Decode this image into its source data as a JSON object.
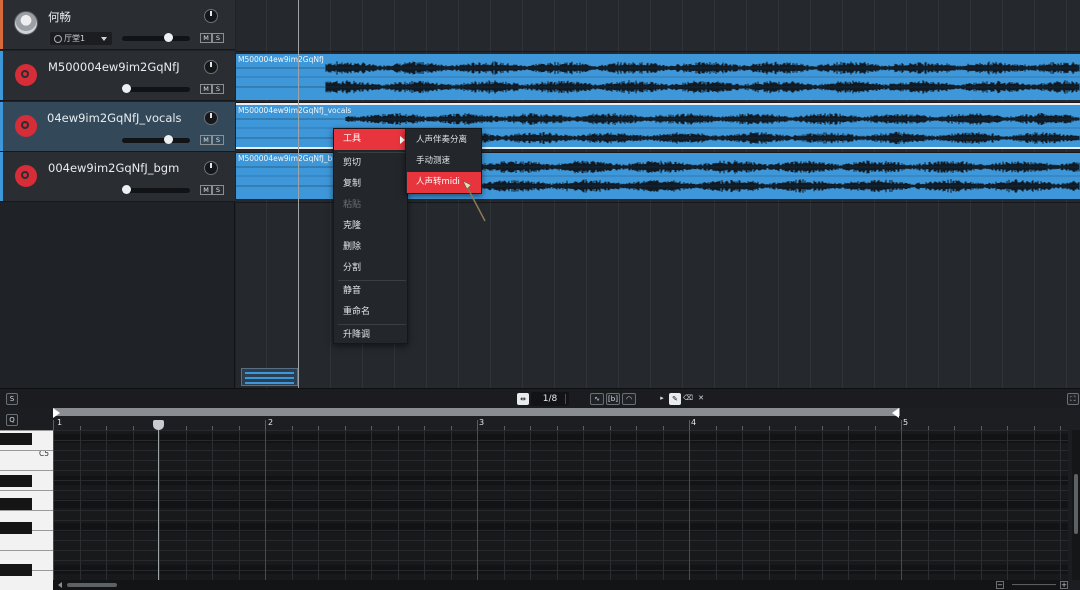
{
  "tracks": [
    {
      "name": "何畅",
      "type": "singer",
      "preset": "厅堂1",
      "strip_color": "#d8693a",
      "volume": 0.8
    },
    {
      "name": "M500004ew9im2GqNfJ",
      "type": "audio",
      "strip_color": "#3e97d9",
      "volume": 0
    },
    {
      "name": "04ew9im2GqNfJ_vocals",
      "type": "audio",
      "selected": true,
      "strip_color": "#3e97d9",
      "volume": 0.8
    },
    {
      "name": "004ew9im2GqNfJ_bgm",
      "type": "audio",
      "strip_color": "#3e97d9",
      "volume": 0
    }
  ],
  "mute_label": "M",
  "solo_label": "S",
  "clips": [
    {
      "title": "M500004ew9im2GqNfJ"
    },
    {
      "title": "M500004ew9im2GqNfJ_vocals",
      "selected": true
    },
    {
      "title": "M500004ew9im2GqNfJ_b"
    }
  ],
  "context_menu": {
    "items": [
      {
        "label": "工具",
        "active": true,
        "has_submenu": true
      },
      {
        "label": "剪切"
      },
      {
        "label": "复制"
      },
      {
        "label": "粘贴",
        "disabled": true
      },
      {
        "label": "克隆"
      },
      {
        "label": "删除"
      },
      {
        "label": "分割"
      },
      {
        "label": "静音"
      },
      {
        "label": "重命名"
      },
      {
        "label": "升降调"
      }
    ],
    "submenu": [
      {
        "label": "人声伴奏分离"
      },
      {
        "label": "手动测速"
      },
      {
        "label": "人声转midi",
        "active": true
      }
    ]
  },
  "toolbar": {
    "s_label": "S",
    "snap_value": "1/8",
    "bracket_label": "[b]",
    "q_label": "Q"
  },
  "piano_roll": {
    "bars": [
      "1",
      "2",
      "3",
      "4",
      "5"
    ],
    "octave_label": "C5"
  },
  "colors": {
    "accent": "#e8343d",
    "clip_blue": "#3e97d9",
    "record_red": "#d72d38"
  }
}
